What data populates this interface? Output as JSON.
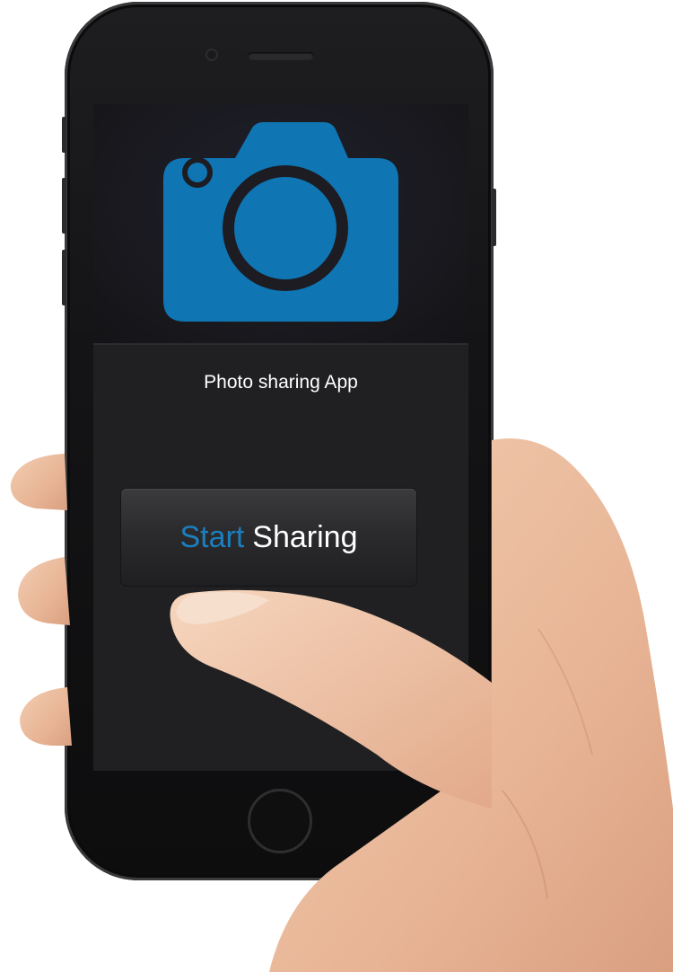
{
  "app": {
    "title": "Photo sharing App",
    "start_button": {
      "word_start": "Start",
      "word_sharing": "Sharing"
    }
  },
  "colors": {
    "accent": "#0f75b3",
    "screen_background": "#202022",
    "button_text_white": "#ffffff"
  },
  "icons": {
    "hero": "camera-icon"
  }
}
